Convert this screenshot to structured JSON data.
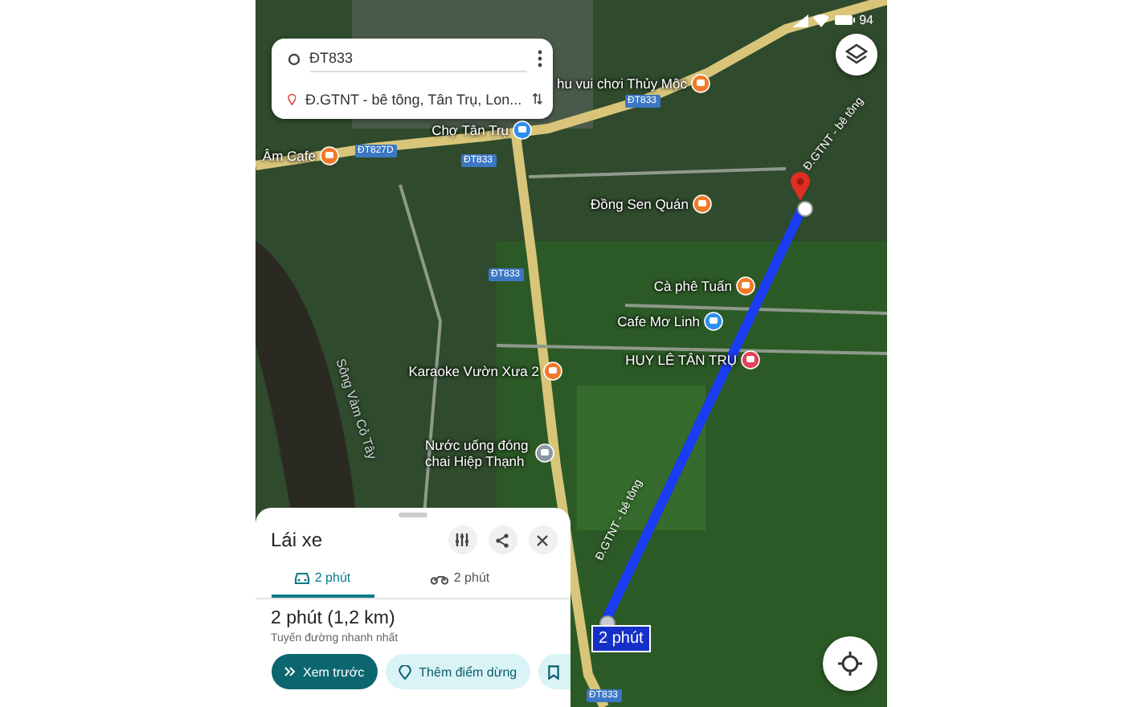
{
  "status_bar": {
    "battery": "94"
  },
  "route_card": {
    "origin": "ĐT833",
    "destination": "Đ.GTNT - bê tông, Tân Trụ, Lon..."
  },
  "map": {
    "places": [
      {
        "name": "hu vui chơi Thủy Mộc",
        "kind": "food"
      },
      {
        "name": "Chợ Tân Trụ",
        "kind": "shop"
      },
      {
        "name": "Âm Cafe",
        "kind": "cafe"
      },
      {
        "name": "Đồng Sen Quán",
        "kind": "food"
      },
      {
        "name": "Cà phê Tuấn",
        "kind": "cafe"
      },
      {
        "name": "Cafe Mơ Linh",
        "kind": "shop"
      },
      {
        "name": "HUY LÊ TÂN TRỤ",
        "kind": "store"
      },
      {
        "name": "Karaoke Vườn Xưa 2",
        "kind": "bar"
      },
      {
        "name": "Nước uống đóng chai Hiệp Thạnh",
        "kind": "place"
      }
    ],
    "road_labels": [
      {
        "text": "ĐT833",
        "kind": "highway"
      },
      {
        "text": "ĐT827D",
        "kind": "highway"
      },
      {
        "text": "ĐT833",
        "kind": "highway"
      },
      {
        "text": "ĐT833",
        "kind": "highway"
      },
      {
        "text": "ĐT833",
        "kind": "highway"
      },
      {
        "text": "Đ.GTNT - bê tông",
        "kind": "street"
      },
      {
        "text": "Đ.GTNT - bê tông",
        "kind": "street"
      }
    ],
    "river_label": "Sông Vàm Cỏ Tây",
    "route_badge": "2 phút"
  },
  "sheet": {
    "title": "Lái xe",
    "tabs": [
      {
        "label": "2 phút",
        "kind": "car",
        "selected": true
      },
      {
        "label": "2 phút",
        "kind": "motorbike",
        "selected": false
      }
    ],
    "summary": "2 phút (1,2 km)",
    "note": "Tuyến đường nhanh nhất",
    "buttons": [
      {
        "label": "Xem trước",
        "kind": "primary"
      },
      {
        "label": "Thêm điểm dừng",
        "kind": "secondary"
      },
      {
        "kind": "save"
      }
    ]
  }
}
